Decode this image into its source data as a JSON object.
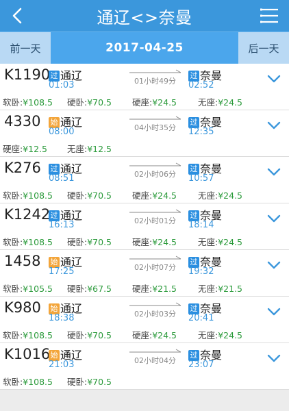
{
  "header": {
    "title": "通辽<>奈曼",
    "prev_day": "前一天",
    "date": "2017-04-25",
    "next_day": "后一天"
  },
  "colors": {
    "header_bg": "#3b97dc",
    "date_bar_bg": "#4ba6ec",
    "time_blue": "#3b97dc",
    "price_green": "#2a9a3a",
    "pass_tag": "#2b8fe0",
    "start_tag": "#f3a53a"
  },
  "trains": [
    {
      "number": "K1190",
      "dep_tag": "过",
      "dep_station": "通辽",
      "dep_time": "01:03",
      "duration": "01小时49分",
      "arr_tag": "过",
      "arr_station": "奈曼",
      "arr_time": "02:52",
      "prices": [
        {
          "label": "软卧:",
          "value": "¥108.5"
        },
        {
          "label": "硬卧:",
          "value": "¥70.5"
        },
        {
          "label": "硬座:",
          "value": "¥24.5"
        },
        {
          "label": "无座:",
          "value": "¥24.5"
        }
      ]
    },
    {
      "number": "4330",
      "dep_tag": "始",
      "dep_station": "通辽",
      "dep_time": "08:00",
      "duration": "04小时35分",
      "arr_tag": "过",
      "arr_station": "奈曼",
      "arr_time": "12:35",
      "prices": [
        {
          "label": "硬座:",
          "value": "¥12.5"
        },
        {
          "label": "无座:",
          "value": "¥12.5"
        }
      ]
    },
    {
      "number": "K276",
      "dep_tag": "过",
      "dep_station": "通辽",
      "dep_time": "08:51",
      "duration": "02小时06分",
      "arr_tag": "过",
      "arr_station": "奈曼",
      "arr_time": "10:57",
      "prices": [
        {
          "label": "软卧:",
          "value": "¥108.5"
        },
        {
          "label": "硬卧:",
          "value": "¥70.5"
        },
        {
          "label": "硬座:",
          "value": "¥24.5"
        },
        {
          "label": "无座:",
          "value": "¥24.5"
        }
      ]
    },
    {
      "number": "K1242",
      "dep_tag": "过",
      "dep_station": "通辽",
      "dep_time": "16:13",
      "duration": "02小时01分",
      "arr_tag": "过",
      "arr_station": "奈曼",
      "arr_time": "18:14",
      "prices": [
        {
          "label": "软卧:",
          "value": "¥108.5"
        },
        {
          "label": "硬卧:",
          "value": "¥70.5"
        },
        {
          "label": "硬座:",
          "value": "¥24.5"
        },
        {
          "label": "无座:",
          "value": "¥24.5"
        }
      ]
    },
    {
      "number": "1458",
      "dep_tag": "始",
      "dep_station": "通辽",
      "dep_time": "17:25",
      "duration": "02小时07分",
      "arr_tag": "过",
      "arr_station": "奈曼",
      "arr_time": "19:32",
      "prices": [
        {
          "label": "软卧:",
          "value": "¥105.5"
        },
        {
          "label": "硬卧:",
          "value": "¥67.5"
        },
        {
          "label": "硬座:",
          "value": "¥21.5"
        },
        {
          "label": "无座:",
          "value": "¥21.5"
        }
      ]
    },
    {
      "number": "K980",
      "dep_tag": "始",
      "dep_station": "通辽",
      "dep_time": "18:38",
      "duration": "02小时03分",
      "arr_tag": "过",
      "arr_station": "奈曼",
      "arr_time": "20:41",
      "prices": [
        {
          "label": "软卧:",
          "value": "¥108.5"
        },
        {
          "label": "硬卧:",
          "value": "¥70.5"
        },
        {
          "label": "硬座:",
          "value": "¥24.5"
        },
        {
          "label": "无座:",
          "value": "¥24.5"
        }
      ]
    },
    {
      "number": "K1016",
      "dep_tag": "始",
      "dep_station": "通辽",
      "dep_time": "21:03",
      "duration": "02小时04分",
      "arr_tag": "过",
      "arr_station": "奈曼",
      "arr_time": "23:07",
      "prices": [
        {
          "label": "软卧:",
          "value": "¥108.5"
        },
        {
          "label": "硬卧:",
          "value": "¥70.5"
        }
      ]
    }
  ]
}
